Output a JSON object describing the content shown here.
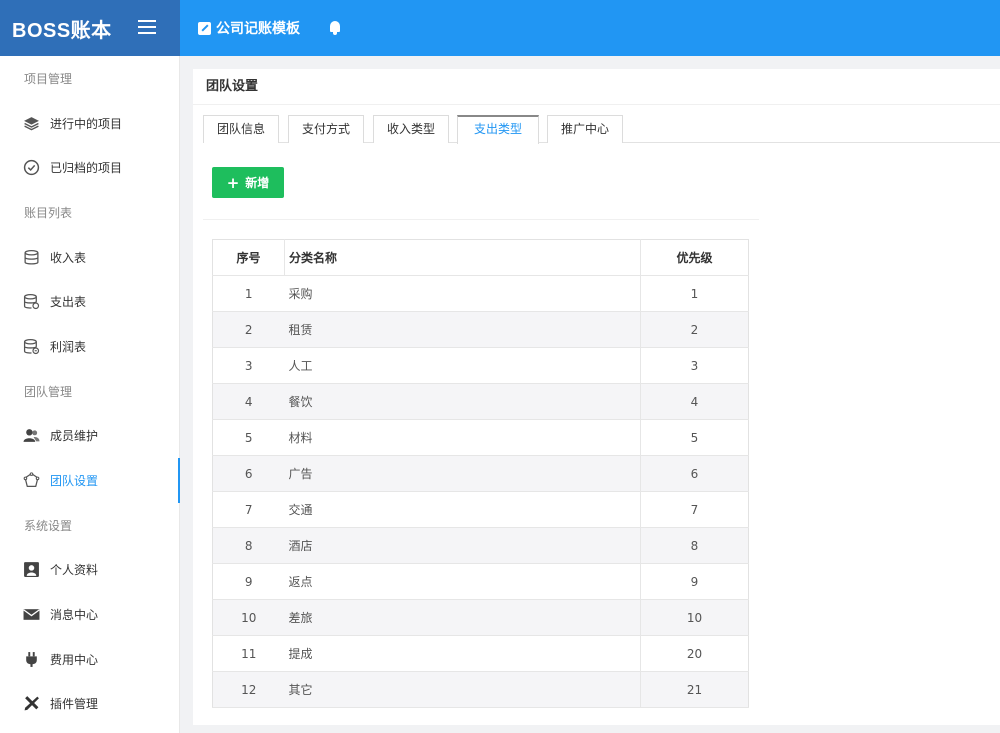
{
  "brand": {
    "title": "BOSS账本"
  },
  "topbar": {
    "template_label": "公司记账模板"
  },
  "sidebar": {
    "sections": [
      {
        "label": "项目管理",
        "items": [
          {
            "label": "进行中的项目",
            "icon": "layers-icon"
          },
          {
            "label": "已归档的项目",
            "icon": "check-circle-icon"
          }
        ]
      },
      {
        "label": "账目列表",
        "items": [
          {
            "label": "收入表",
            "icon": "database-icon"
          },
          {
            "label": "支出表",
            "icon": "database-out-icon"
          },
          {
            "label": "利润表",
            "icon": "database-profit-icon"
          }
        ]
      },
      {
        "label": "团队管理",
        "items": [
          {
            "label": "成员维护",
            "icon": "users-icon"
          },
          {
            "label": "团队设置",
            "icon": "team-settings-icon",
            "active": true
          }
        ]
      },
      {
        "label": "系统设置",
        "items": [
          {
            "label": "个人资料",
            "icon": "profile-icon"
          },
          {
            "label": "消息中心",
            "icon": "envelope-icon"
          },
          {
            "label": "费用中心",
            "icon": "plug-icon"
          },
          {
            "label": "插件管理",
            "icon": "tools-icon"
          }
        ]
      }
    ]
  },
  "card": {
    "title": "团队设置",
    "tabs": [
      {
        "label": "团队信息"
      },
      {
        "label": "支付方式"
      },
      {
        "label": "收入类型"
      },
      {
        "label": "支出类型",
        "active": true
      },
      {
        "label": "推广中心"
      }
    ],
    "add_button": "新增"
  },
  "table": {
    "headers": {
      "no": "序号",
      "name": "分类名称",
      "priority": "优先级"
    },
    "rows": [
      {
        "no": "1",
        "name": "采购",
        "priority": "1"
      },
      {
        "no": "2",
        "name": "租赁",
        "priority": "2"
      },
      {
        "no": "3",
        "name": "人工",
        "priority": "3"
      },
      {
        "no": "4",
        "name": "餐饮",
        "priority": "4"
      },
      {
        "no": "5",
        "name": "材料",
        "priority": "5"
      },
      {
        "no": "6",
        "name": "广告",
        "priority": "6"
      },
      {
        "no": "7",
        "name": "交通",
        "priority": "7"
      },
      {
        "no": "8",
        "name": "酒店",
        "priority": "8"
      },
      {
        "no": "9",
        "name": "返点",
        "priority": "9"
      },
      {
        "no": "10",
        "name": "差旅",
        "priority": "10"
      },
      {
        "no": "11",
        "name": "提成",
        "priority": "20"
      },
      {
        "no": "12",
        "name": "其它",
        "priority": "21"
      }
    ]
  },
  "colors": {
    "brand": "#2f6fb8",
    "topbar": "#2196f3",
    "accent": "#2196f3",
    "add_button": "#1ebe5d"
  }
}
